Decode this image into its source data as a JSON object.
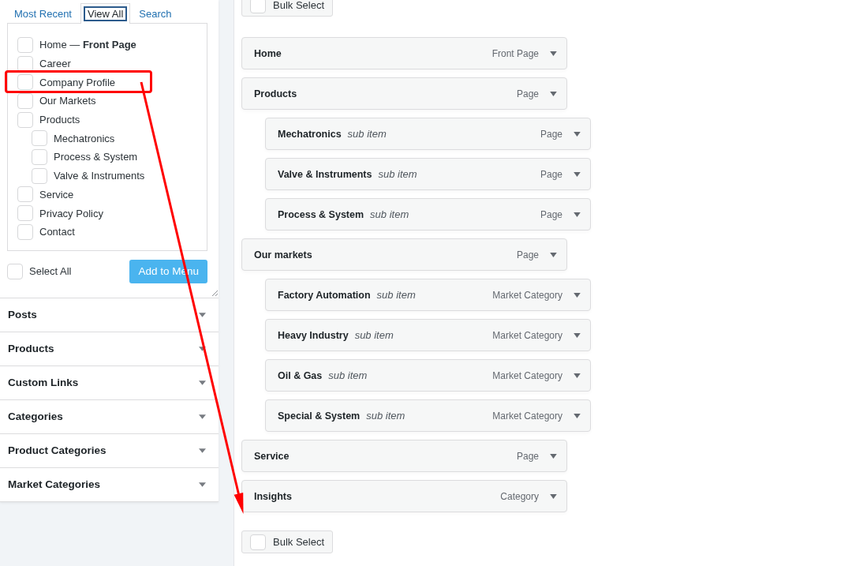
{
  "pages_panel": {
    "tabs": [
      {
        "label": "Most Recent",
        "selected": false
      },
      {
        "label": "View All",
        "selected": true
      },
      {
        "label": "Search",
        "selected": false
      }
    ],
    "items": [
      {
        "label": "Home — **Front Page**",
        "checked": false,
        "highlighted": false
      },
      {
        "label": "Career",
        "checked": false,
        "highlighted": false
      },
      {
        "label": "Company Profile",
        "checked": false,
        "highlighted": true
      },
      {
        "label": "Our Markets",
        "checked": false,
        "highlighted": false
      },
      {
        "label": "Products",
        "checked": false,
        "highlighted": false,
        "children": [
          {
            "label": "Mechatronics",
            "checked": false,
            "highlighted": false
          },
          {
            "label": "Process & System",
            "checked": false,
            "highlighted": false
          },
          {
            "label": "Valve & Instruments",
            "checked": false,
            "highlighted": false
          }
        ]
      },
      {
        "label": "Service",
        "checked": false,
        "highlighted": false
      },
      {
        "label": "Privacy Policy",
        "checked": false,
        "highlighted": false
      },
      {
        "label": "Contact",
        "checked": false,
        "highlighted": false
      }
    ],
    "select_all": {
      "label": "Select All",
      "checked": false
    },
    "add_button": {
      "label": "Add to Menu"
    }
  },
  "accordion_sections": [
    {
      "title": "Posts"
    },
    {
      "title": "Products"
    },
    {
      "title": "Custom Links"
    },
    {
      "title": "Categories"
    },
    {
      "title": "Product Categories"
    },
    {
      "title": "Market Categories"
    }
  ],
  "menu": {
    "bulk_select_top": {
      "label": "Bulk Select",
      "checked": false
    },
    "items": [
      {
        "title": "Home",
        "type": "Front Page"
      },
      {
        "title": "Products",
        "type": "Page",
        "children": [
          {
            "title": "Mechatronics",
            "note": "sub item",
            "type": "Page"
          },
          {
            "title": "Valve & Instruments",
            "note": "sub item",
            "type": "Page"
          },
          {
            "title": "Process & System",
            "note": "sub item",
            "type": "Page"
          }
        ]
      },
      {
        "title": "Our markets",
        "type": "Page",
        "children": [
          {
            "title": "Factory Automation",
            "note": "sub item",
            "type": "Market Category"
          },
          {
            "title": "Heavy Industry",
            "note": "sub item",
            "type": "Market Category"
          },
          {
            "title": "Oil & Gas",
            "note": "sub item",
            "type": "Market Category"
          },
          {
            "title": "Special & System",
            "note": "sub item",
            "type": "Market Category"
          }
        ]
      },
      {
        "title": "Service",
        "type": "Page"
      },
      {
        "title": "Insights",
        "type": "Category"
      }
    ],
    "bulk_select_bottom": {
      "label": "Bulk Select",
      "checked": false
    }
  }
}
